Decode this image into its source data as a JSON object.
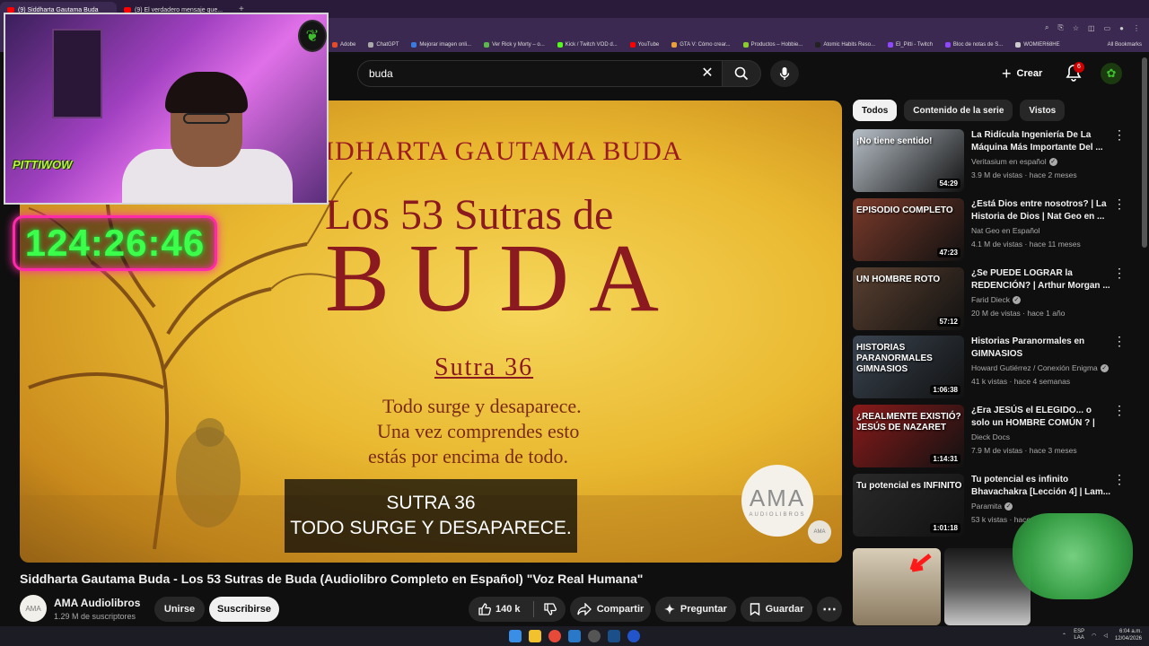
{
  "browser": {
    "tabs": [
      {
        "title": "(9) Siddharta Gautama Buda"
      },
      {
        "title": "(9) El verdadero mensaje que..."
      }
    ],
    "bookmarks": [
      {
        "label": "Adobe",
        "color": "#e34b2a"
      },
      {
        "label": "ChatGPT",
        "color": "#aaaaaa"
      },
      {
        "label": "Mejorar imagen onli...",
        "color": "#3a7be0"
      },
      {
        "label": "Ver Rick y Morty – o...",
        "color": "#5bb84a"
      },
      {
        "label": "Kick / Twitch VOD d...",
        "color": "#53fc18"
      },
      {
        "label": "YouTube",
        "color": "#ff0000"
      },
      {
        "label": "GTA V: Cómo crear...",
        "color": "#e9a23b"
      },
      {
        "label": "Productos – Hobbie...",
        "color": "#8acb2f"
      },
      {
        "label": "Atomic Habits Reso...",
        "color": "#222222"
      },
      {
        "label": "El_Pitti - Twitch",
        "color": "#9146ff"
      },
      {
        "label": "Bloc de notas de S...",
        "color": "#9146ff"
      },
      {
        "label": "WOMIER68HE",
        "color": "#cccccc"
      }
    ],
    "all_bookmarks": "All Bookmarks"
  },
  "header": {
    "search_value": "buda",
    "create_label": "Crear",
    "notification_count": "6"
  },
  "overlay": {
    "timer": "124:26:46",
    "brand": "PITTIWOW"
  },
  "video": {
    "heading": "IDHARTA GAUTAMA BUDA",
    "subtitle": "Los 53 Sutras de",
    "big_title": "BUDA",
    "sutra_label": "Sutra 36",
    "body_lines": [
      "Todo surge y desaparece.",
      "Una vez comprendes esto",
      "estás por encima de todo."
    ],
    "captions": [
      "SUTRA 36",
      "TODO SURGE Y DESAPARECE."
    ],
    "logo_main": "AMA",
    "logo_sub": "AUDIOLIBROS",
    "logo_small": "AMA"
  },
  "info": {
    "title": "Siddharta Gautama Buda - Los 53 Sutras de Buda (Audiolibro Completo en Español) \"Voz Real Humana\"",
    "channel": "AMA Audiolibros",
    "subscribers": "1.29 M de suscriptores",
    "join_label": "Unirse",
    "subscribe_label": "Suscribirse",
    "likes": "140 k",
    "share_label": "Compartir",
    "ask_label": "Preguntar",
    "save_label": "Guardar",
    "channel_avatar_text": "AMA"
  },
  "chips": [
    "Todos",
    "Contenido de la serie",
    "Vistos"
  ],
  "recommendations": [
    {
      "thumb_text": "¡No tiene sentido!",
      "duration": "54:29",
      "title": "La Ridícula Ingeniería De La Máquina Más Importante Del ...",
      "channel": "Veritasium en español",
      "verified": true,
      "meta": "3.9 M de vistas · hace 2 meses",
      "color": "#b8c0c8"
    },
    {
      "thumb_text": "EPISODIO COMPLETO",
      "duration": "47:23",
      "title": "¿Está Dios entre nosotros? | La Historia de Dios | Nat Geo en ...",
      "channel": "Nat Geo en Español",
      "verified": false,
      "meta": "4.1 M de vistas · hace 11 meses",
      "color": "#7a3a2a"
    },
    {
      "thumb_text": "UN HOMBRE ROTO",
      "duration": "57:12",
      "title": "¿Se PUEDE LOGRAR la REDENCIÓN? | Arthur Morgan ...",
      "channel": "Farid Dieck",
      "verified": true,
      "meta": "20 M de vistas · hace 1 año",
      "color": "#5a4030"
    },
    {
      "thumb_text": "HISTORIAS PARANORMALES GIMNASIOS",
      "duration": "1:06:38",
      "title": "Historias Paranormales en GIMNASIOS",
      "channel": "Howard Gutiérrez / Conexión Enigma",
      "verified": true,
      "meta": "41 k vistas · hace 4 semanas",
      "color": "#3a4450"
    },
    {
      "thumb_text": "¿REALMENTE EXISTIÓ? JESÚS DE NAZARET",
      "duration": "1:14:31",
      "title": "¿Era JESÚS el ELEGIDO... o solo un HOMBRE COMÚN ? | Jesús ...",
      "channel": "Dieck Docs",
      "verified": false,
      "meta": "7.9 M de vistas · hace 3 meses",
      "color": "#8a1a1a"
    },
    {
      "thumb_text": "Tu potencial es INFINITO",
      "duration": "1:01:18",
      "title": "Tu potencial es infinito Bhavachakra [Lección 4] | Lam...",
      "channel": "Paramita",
      "verified": true,
      "meta": "53 k vistas · hace",
      "color": "#2a2a2a"
    }
  ],
  "taskbar": {
    "lang": [
      "ESP",
      "LAA"
    ],
    "time": "6:04 a.m.",
    "date": "12/04/2026"
  }
}
